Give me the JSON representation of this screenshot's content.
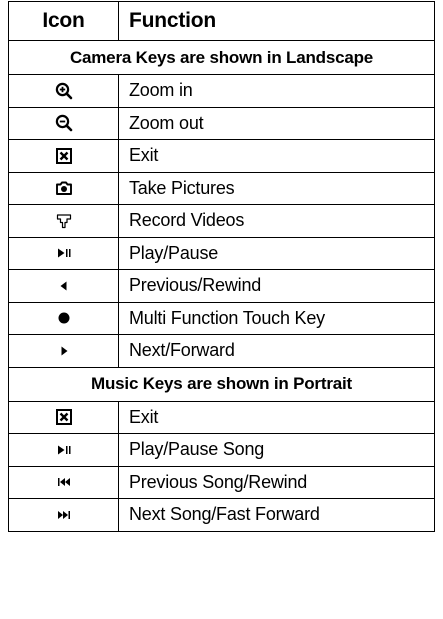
{
  "table": {
    "headers": {
      "icon": "Icon",
      "function": "Function"
    },
    "sections": [
      {
        "title": "Camera Keys are shown in Landscape",
        "rows": [
          {
            "icon": "zoom-in-icon",
            "label": "Zoom in"
          },
          {
            "icon": "zoom-out-icon",
            "label": "Zoom out"
          },
          {
            "icon": "exit-icon",
            "label": "Exit"
          },
          {
            "icon": "camera-icon",
            "label": "Take Pictures"
          },
          {
            "icon": "video-camera-icon",
            "label": "Record Videos"
          },
          {
            "icon": "play-pause-icon",
            "label": "Play/Pause"
          },
          {
            "icon": "previous-icon",
            "label": "Previous/Rewind"
          },
          {
            "icon": "multi-function-dot-icon",
            "label": "Multi Function Touch Key"
          },
          {
            "icon": "next-icon",
            "label": "Next/Forward"
          }
        ]
      },
      {
        "title": "Music Keys are shown in Portrait",
        "rows": [
          {
            "icon": "exit-icon",
            "label": "Exit"
          },
          {
            "icon": "play-pause-icon",
            "label": "Play/Pause Song"
          },
          {
            "icon": "previous-song-icon",
            "label": "Previous Song/Rewind"
          },
          {
            "icon": "next-song-icon",
            "label": "Next Song/Fast Forward"
          }
        ]
      }
    ]
  }
}
